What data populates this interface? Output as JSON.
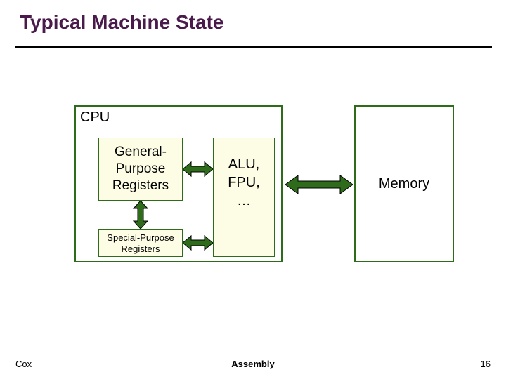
{
  "title": "Typical Machine State",
  "cpu": {
    "label": "CPU",
    "gpr": "General-\nPurpose\nRegisters",
    "spr": "Special-Purpose\nRegisters",
    "alu": "ALU,\nFPU,\n…"
  },
  "memory": "Memory",
  "footer": {
    "left": "Cox",
    "center": "Assembly",
    "page": "16"
  },
  "colors": {
    "arrow_fill": "#2e6b1a",
    "arrow_stroke": "#000"
  },
  "chart_data": {
    "type": "diagram",
    "title": "Typical Machine State",
    "nodes": [
      {
        "id": "cpu",
        "label": "CPU",
        "children": [
          "gpr",
          "spr",
          "alu"
        ]
      },
      {
        "id": "gpr",
        "label": "General-Purpose Registers"
      },
      {
        "id": "spr",
        "label": "Special-Purpose Registers"
      },
      {
        "id": "alu",
        "label": "ALU, FPU, …"
      },
      {
        "id": "memory",
        "label": "Memory"
      }
    ],
    "edges": [
      {
        "from": "gpr",
        "to": "alu",
        "bidirectional": true
      },
      {
        "from": "spr",
        "to": "alu",
        "bidirectional": true
      },
      {
        "from": "gpr",
        "to": "spr",
        "bidirectional": true
      },
      {
        "from": "cpu",
        "to": "memory",
        "bidirectional": true
      }
    ]
  }
}
